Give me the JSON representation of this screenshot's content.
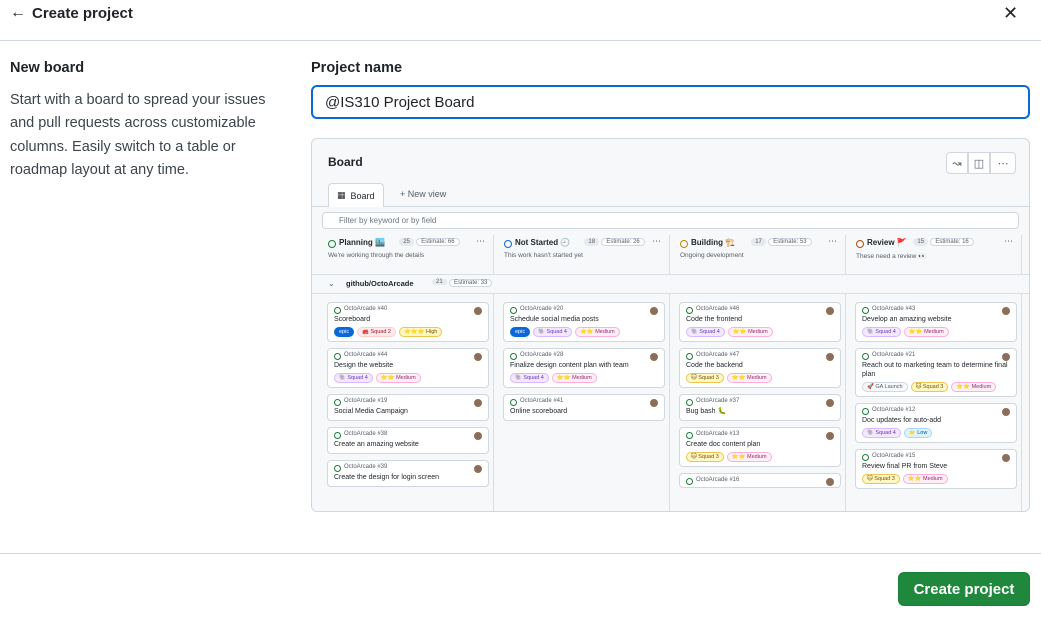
{
  "header": {
    "back_icon": "arrow-left-icon",
    "title": "Create project",
    "close_icon": "close-icon"
  },
  "template": {
    "title": "New board",
    "description": "Start with a board to spread your issues and pull requests across customizable columns. Easily switch to a table or roadmap layout at any time."
  },
  "form": {
    "name_label": "Project name",
    "name_value": "@IS310 Project Board"
  },
  "preview": {
    "title": "Board",
    "tab_board": "Board",
    "tab_new_view": "+ New view",
    "filter_placeholder": "Filter by keyword or by field",
    "group": {
      "name": "github/OctoArcade",
      "count": "21",
      "estimate": "Estimate: 33"
    },
    "columns": [
      {
        "name": "Planning 🏙️",
        "count": "25",
        "estimate": "Estimate: 66",
        "subtitle": "We're working through the details",
        "color": "#1a7f37"
      },
      {
        "name": "Not Started 🕘",
        "count": "18",
        "estimate": "Estimate: 26",
        "subtitle": "This work hasn't started yet",
        "color": "#0969da"
      },
      {
        "name": "Building 🏗️",
        "count": "17",
        "estimate": "Estimate: 53",
        "subtitle": "Ongoing development",
        "color": "#bf8700"
      },
      {
        "name": "Review 🚩",
        "count": "15",
        "estimate": "Estimate: 16",
        "subtitle": "These need a review 👀",
        "color": "#bc4c00"
      }
    ],
    "cards": [
      [
        {
          "ref": "OctoArcade #40",
          "title": "Scoreboard",
          "labels": [
            "epic",
            "🚒 Squad 2",
            "⭐⭐⭐ High"
          ]
        },
        {
          "ref": "OctoArcade #44",
          "title": "Design the website",
          "labels": [
            "🐘 Squad 4",
            "⭐⭐ Medium"
          ]
        },
        {
          "ref": "OctoArcade #19",
          "title": "Social Media Campaign",
          "labels": []
        },
        {
          "ref": "OctoArcade #38",
          "title": "Create an amazing website",
          "labels": []
        },
        {
          "ref": "OctoArcade #39",
          "title": "Create the design for login screen",
          "labels": []
        }
      ],
      [
        {
          "ref": "OctoArcade #20",
          "title": "Schedule social media posts",
          "labels": [
            "epic",
            "🐘 Squad 4",
            "⭐⭐ Medium"
          ]
        },
        {
          "ref": "OctoArcade #28",
          "title": "Finalize design content plan with team",
          "labels": [
            "🐘 Squad 4",
            "⭐⭐ Medium"
          ]
        },
        {
          "ref": "OctoArcade #41",
          "title": "Online scoreboard",
          "labels": []
        }
      ],
      [
        {
          "ref": "OctoArcade #46",
          "title": "Code the frontend",
          "labels": [
            "🐘 Squad 4",
            "⭐⭐ Medium"
          ]
        },
        {
          "ref": "OctoArcade #47",
          "title": "Code the backend",
          "labels": [
            "🐱 Squad 3",
            "⭐⭐ Medium"
          ]
        },
        {
          "ref": "OctoArcade #37",
          "title": "Bug bash 🐛",
          "labels": []
        },
        {
          "ref": "OctoArcade #13",
          "title": "Create doc content plan",
          "labels": [
            "🐱 Squad 3",
            "⭐⭐ Medium"
          ]
        },
        {
          "ref": "OctoArcade #16",
          "title": "",
          "labels": []
        }
      ],
      [
        {
          "ref": "OctoArcade #43",
          "title": "Develop an amazing website",
          "labels": [
            "🐘 Squad 4",
            "⭐⭐ Medium"
          ]
        },
        {
          "ref": "OctoArcade #21",
          "title": "Reach out to marketing team to determine final plan",
          "labels": [
            "🚀 GA Launch",
            "🐱 Squad 3",
            "⭐⭐ Medium"
          ]
        },
        {
          "ref": "OctoArcade #12",
          "title": "Doc updates for auto-add",
          "labels": [
            "🐘 Squad 4",
            "⭐ Low"
          ]
        },
        {
          "ref": "OctoArcade #15",
          "title": "Review final PR from Steve",
          "labels": [
            "🐱 Squad 3",
            "⭐⭐ Medium"
          ]
        }
      ]
    ]
  },
  "footer": {
    "create_label": "Create project"
  }
}
